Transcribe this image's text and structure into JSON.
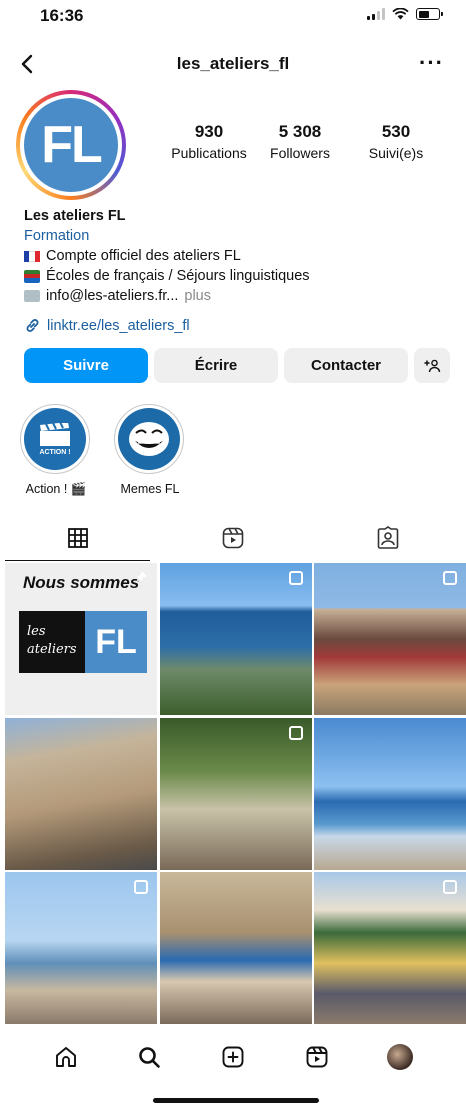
{
  "status": {
    "time": "16:36"
  },
  "nav": {
    "title": "les_ateliers_fl",
    "more": "···"
  },
  "profile": {
    "avatar_text": "FL",
    "stats": [
      {
        "value": "930",
        "label": "Publications"
      },
      {
        "value": "5 308",
        "label": "Followers"
      },
      {
        "value": "530",
        "label": "Suivi(e)s"
      }
    ],
    "name": "Les ateliers FL",
    "category": "Formation",
    "bio_lines": [
      "Compte officiel des ateliers FL",
      "Écoles de français / Séjours linguistiques",
      "info@les-ateliers.fr..."
    ],
    "more_label": "plus",
    "link": "linktr.ee/les_ateliers_fl"
  },
  "actions": {
    "follow": "Suivre",
    "write": "Écrire",
    "contact": "Contacter"
  },
  "highlights": [
    {
      "label": "Action ! 🎬",
      "caption": "ACTION !"
    },
    {
      "label": "Memes FL"
    }
  ],
  "grid": {
    "first_post_title": "Nous sommes",
    "first_post_logo_left": "les ateliers",
    "first_post_logo_right": "FL"
  },
  "icons": {
    "tabs": [
      "grid-icon",
      "reels-icon",
      "tagged-icon"
    ],
    "bottom_nav": [
      "home-icon",
      "search-icon",
      "create-icon",
      "reels-icon",
      "profile-avatar"
    ]
  },
  "colors": {
    "follow_button": "#0095f6",
    "link": "#1b5fa0",
    "avatar_bg": "#4a8cc7"
  }
}
